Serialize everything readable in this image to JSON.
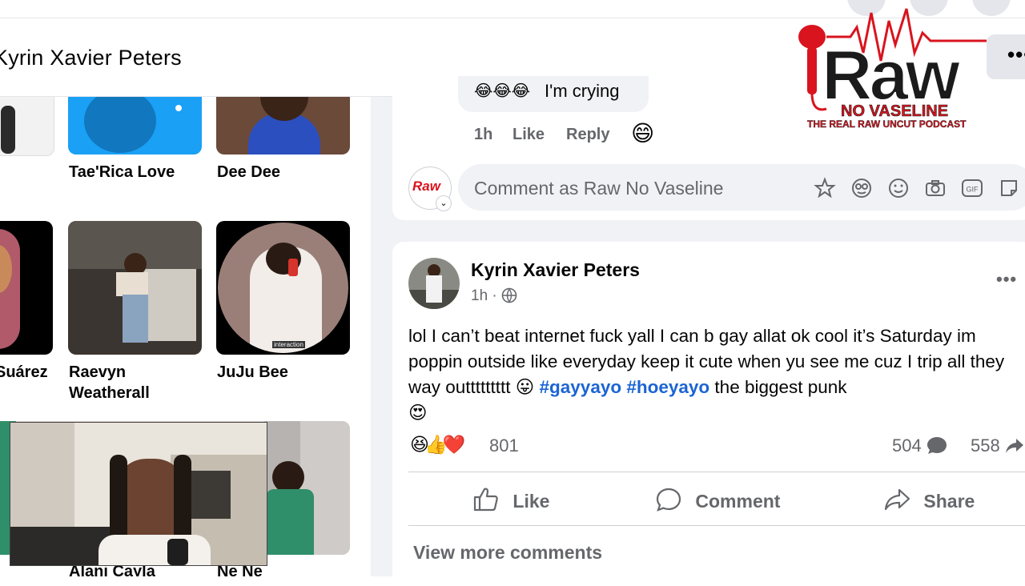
{
  "header": {
    "profile_name": "Kyrin Xavier Peters",
    "more_label": "•••"
  },
  "logo": {
    "brand": "Raw",
    "tagline": "NO VASELINE",
    "subtitle": "THE REAL RAW UNCUT PODCAST"
  },
  "friends": {
    "items": [
      {
        "label": "Tae'Rica Love"
      },
      {
        "label": "Dee Dee"
      },
      {
        "label": "Suárez"
      },
      {
        "label": "Raevyn\nWeatherall"
      },
      {
        "label": "JuJu Bee"
      },
      {
        "label": "Alani Cayla"
      },
      {
        "label": "Ne Ne"
      }
    ],
    "sticker_text": "interaction"
  },
  "prev_comment": {
    "text": "I'm crying",
    "emojis": "😂😂😂",
    "time": "1h",
    "like_label": "Like",
    "reply_label": "Reply",
    "reaction_emoji": "😄"
  },
  "comment_box": {
    "placeholder": "Comment as Raw No Vaseline",
    "icons": [
      "avatar-sticker-icon",
      "emoji-face-icon",
      "smiley-icon",
      "camera-icon",
      "gif-icon",
      "sticker-icon"
    ],
    "gif_label": "GIF",
    "avatar_label": "Raw"
  },
  "post": {
    "author": "Kyrin Xavier Peters",
    "time": "1h · ",
    "text_part1": "lol I can’t beat internet fuck yall I can b gay allat ok cool it’s Saturday im poppin outside like everyday keep it cute when yu see me cuz I trip all they way outtttttttt 😛 ",
    "hashtag1": "#gayyayo",
    "hashtag2": "#hoeyayo",
    "text_part2": " the biggest punk",
    "text_emoji": "😍",
    "more_label": "•••",
    "reactions": "😆👍❤️",
    "reaction_count": "801",
    "comments_count": "504",
    "shares_count": "558",
    "actions": {
      "like": "Like",
      "comment": "Comment",
      "share": "Share"
    },
    "view_more": "View more comments"
  },
  "colors": {
    "accent_link": "#1b64d4",
    "muted_text": "#65676b",
    "logo_red": "#d9141e",
    "feed_bg": "#f0f2f5"
  }
}
